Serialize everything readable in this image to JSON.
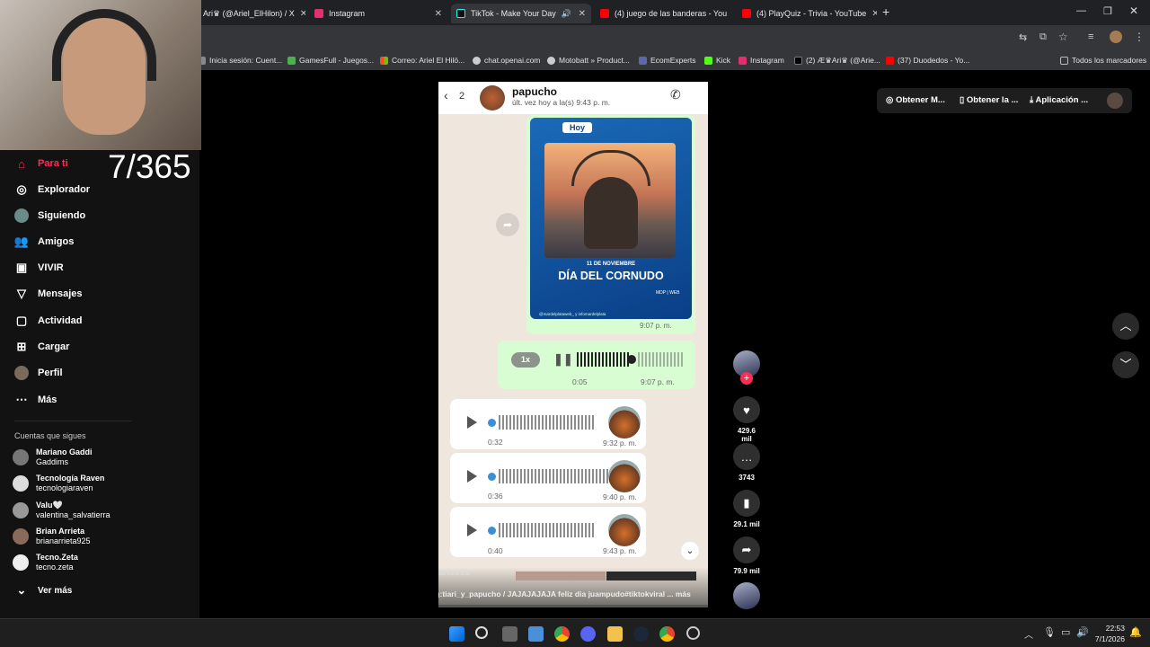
{
  "browser": {
    "tabs": [
      {
        "label": "Ari♛ (@Ariel_ElHilon) / X",
        "color": "#000000"
      },
      {
        "label": "Instagram",
        "color": "#e1306c"
      },
      {
        "label": "TikTok - Make Your Day",
        "color": "#111111"
      },
      {
        "label": "(4) juego de las banderas - You",
        "color": "#ff0000"
      },
      {
        "label": "(4) PlayQuiz - Trivia - YouTube",
        "color": "#ff0000"
      }
    ],
    "bookmarks": [
      "Inicia sesión: Cuent...",
      "GamesFull - Juegos...",
      "Correo: Ariel El Hilö...",
      "chat.openai.com",
      "Motobatt » Product...",
      "EcomExperts",
      "Kick",
      "Instagram",
      "(2) Æ♛Ari♛ (@Arie...",
      "(37) Duodedos - Yo...",
      "Todos los marcadores"
    ]
  },
  "sidebar": {
    "nav": [
      {
        "label": "Para ti",
        "icon": "home-icon"
      },
      {
        "label": "Explorador",
        "icon": "compass-icon"
      },
      {
        "label": "Siguiendo",
        "icon": "following-avatar"
      },
      {
        "label": "Amigos",
        "icon": "friends-icon"
      },
      {
        "label": "VIVIR",
        "icon": "live-icon"
      },
      {
        "label": "Mensajes",
        "icon": "messages-icon"
      },
      {
        "label": "Actividad",
        "icon": "activity-icon"
      },
      {
        "label": "Cargar",
        "icon": "upload-icon"
      },
      {
        "label": "Perfil",
        "icon": "profile-icon"
      },
      {
        "label": "Más",
        "icon": "more-icon"
      }
    ],
    "following_title": "Cuentas que sigues",
    "accounts": [
      {
        "name": "Mariano Gaddi",
        "handle": "Gaddims"
      },
      {
        "name": "Tecnología Raven",
        "handle": "tecnologiaraven"
      },
      {
        "name": "Valu🤍",
        "handle": "valentina_salvatierra"
      },
      {
        "name": "Brian Arrieta",
        "handle": "brianarrieta925"
      },
      {
        "name": "Tecno.Zeta",
        "handle": "tecno.zeta"
      }
    ],
    "see_more": "Ver más"
  },
  "overlay": {
    "counter": "7/365"
  },
  "topbar": {
    "btn1": "Obtener M...",
    "btn2": "Obtener la ...",
    "btn3": "Aplicación ..."
  },
  "video": {
    "contact_name": "papucho",
    "back_count": "2",
    "last_seen": "últ. vez hoy a la(s) 9:43 p. m.",
    "image_badge": "Hoy",
    "image_date": "11 DE NOVIEMBRE",
    "image_title": "DÍA DEL CORNUDO",
    "image_brand": "MDP | WEB",
    "image_credit": "@mardelplataweb_ y infomardelplata",
    "image_time": "9:07 p. m.",
    "sent_audio": {
      "speed": "1x",
      "elapsed": "0:05",
      "time": "9:07 p. m."
    },
    "received_audios": [
      {
        "duration": "0:32",
        "time": "9:32 p. m."
      },
      {
        "duration": "0:36",
        "time": "9:40 p. m."
      },
      {
        "duration": "0:40",
        "time": "9:43 p. m."
      }
    ],
    "author": "tiarissss",
    "caption": "ig:tiari_y_papucho / JAJAJAJAJA feliz dia juampudo#tiktokviral ... más"
  },
  "actions": {
    "likes": "429.6 mil",
    "comments": "3743",
    "saves": "29.1 mil",
    "shares": "79.9 mil"
  },
  "taskbar": {
    "time": "22:53",
    "date": "7/1/2026"
  },
  "colors": {
    "accent": "#fe2c55",
    "whatsapp_sent": "#d9fdd3",
    "whatsapp_blue": "#0a5db8"
  }
}
